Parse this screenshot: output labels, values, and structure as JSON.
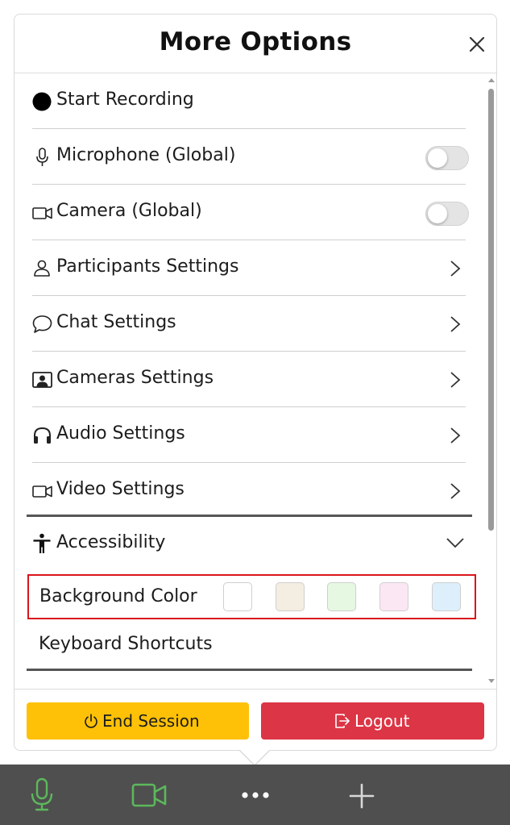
{
  "panel": {
    "title": "More Options",
    "close_icon": "close-icon"
  },
  "menu": {
    "start_recording": {
      "label": "Start Recording",
      "icon": "record-dot-icon"
    },
    "microphone": {
      "label": "Microphone (Global)",
      "icon": "microphone-icon",
      "enabled": false
    },
    "camera": {
      "label": "Camera (Global)",
      "icon": "camera-icon",
      "enabled": false
    },
    "participants": {
      "label": "Participants Settings",
      "icon": "person-icon"
    },
    "chat": {
      "label": "Chat Settings",
      "icon": "chat-bubble-icon"
    },
    "cameras": {
      "label": "Cameras Settings",
      "icon": "portrait-icon"
    },
    "audio": {
      "label": "Audio Settings",
      "icon": "headphones-icon"
    },
    "video": {
      "label": "Video Settings",
      "icon": "video-camera-icon"
    }
  },
  "accessibility": {
    "label": "Accessibility",
    "icon": "accessibility-person-icon",
    "expanded": true,
    "background_color": {
      "label": "Background Color",
      "swatches": [
        "#ffffff",
        "#f4ede1",
        "#e6f8e2",
        "#fbe7f4",
        "#ddeffb"
      ]
    },
    "keyboard_shortcuts": {
      "label": "Keyboard Shortcuts"
    }
  },
  "footer": {
    "end_session": {
      "label": "End Session",
      "icon": "power-icon",
      "color": "#fec107"
    },
    "logout": {
      "label": "Logout",
      "icon": "logout-icon",
      "color": "#dc3545"
    }
  },
  "toolbar": {
    "background": "#4f4f4f",
    "accent": "#5cb85c",
    "items": [
      "microphone-icon",
      "video-camera-icon",
      "more-options-icon",
      "add-icon"
    ]
  }
}
